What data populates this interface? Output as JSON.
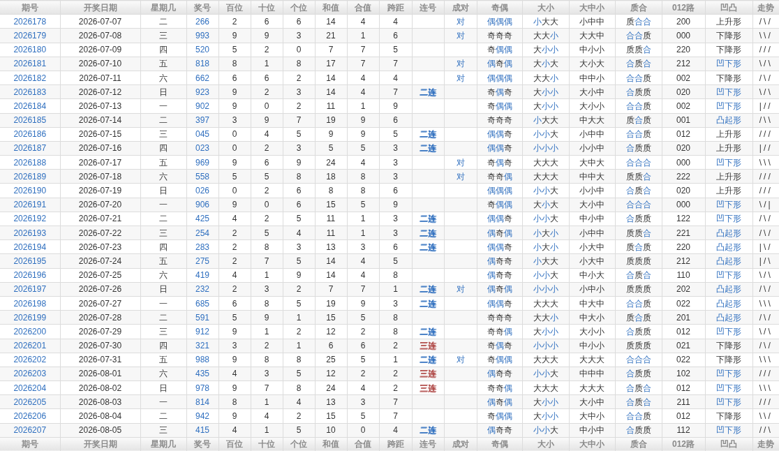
{
  "columns": [
    "期号",
    "开奖日期",
    "星期几",
    "奖号",
    "百位",
    "十位",
    "个位",
    "和值",
    "合值",
    "跨距",
    "连号",
    "成对",
    "奇偶",
    "大小",
    "大中小",
    "质合",
    "012路",
    "凹凸",
    "走势"
  ],
  "rows": [
    {
      "issue": "2026178",
      "date": "2026-07-07",
      "weekday": "二",
      "number": "266",
      "hundreds": "2",
      "tens": "6",
      "units": "6",
      "sum": "14",
      "sum_tail": "4",
      "span": "4",
      "pair": "对",
      "odd_even": [
        {
          "text": "偶偶偶",
          "highlight": true
        }
      ],
      "big_small": [
        {
          "text": "小",
          "highlight": true
        },
        {
          "text": "大大",
          "highlight": false
        }
      ],
      "big_mid_small": "小中中",
      "prime_composite": [
        {
          "text": "质",
          "highlight": false
        },
        {
          "text": "合合",
          "highlight": true
        }
      ],
      "route_012": "200",
      "shape": {
        "text": "上升形",
        "highlight": false
      },
      "trend": "/\\/"
    },
    {
      "issue": "2026179",
      "date": "2026-07-08",
      "weekday": "三",
      "number": "993",
      "hundreds": "9",
      "tens": "9",
      "units": "3",
      "sum": "21",
      "sum_tail": "1",
      "span": "6",
      "pair": "对",
      "odd_even": [
        {
          "text": "奇奇奇",
          "highlight": false
        }
      ],
      "big_small": [
        {
          "text": "大大",
          "highlight": false
        },
        {
          "text": "小",
          "highlight": true
        }
      ],
      "big_mid_small": "大大中",
      "prime_composite": [
        {
          "text": "合合",
          "highlight": true
        },
        {
          "text": "质",
          "highlight": false
        }
      ],
      "route_012": "000",
      "shape": {
        "text": "下降形",
        "highlight": false
      },
      "trend": "\\\\/"
    },
    {
      "issue": "2026180",
      "date": "2026-07-09",
      "weekday": "四",
      "number": "520",
      "hundreds": "5",
      "tens": "2",
      "units": "0",
      "sum": "7",
      "sum_tail": "7",
      "span": "5",
      "odd_even": [
        {
          "text": "奇",
          "highlight": false
        },
        {
          "text": "偶偶",
          "highlight": true
        }
      ],
      "big_small": [
        {
          "text": "大",
          "highlight": false
        },
        {
          "text": "小小",
          "highlight": true
        }
      ],
      "big_mid_small": "中小小",
      "prime_composite": [
        {
          "text": "质质",
          "highlight": false
        },
        {
          "text": "合",
          "highlight": true
        }
      ],
      "route_012": "220",
      "shape": {
        "text": "下降形",
        "highlight": false
      },
      "trend": "///"
    },
    {
      "issue": "2026181",
      "date": "2026-07-10",
      "weekday": "五",
      "number": "818",
      "hundreds": "8",
      "tens": "1",
      "units": "8",
      "sum": "17",
      "sum_tail": "7",
      "span": "7",
      "pair": "对",
      "odd_even": [
        {
          "text": "偶",
          "highlight": true
        },
        {
          "text": "奇",
          "highlight": false
        },
        {
          "text": "偶",
          "highlight": true
        }
      ],
      "big_small": [
        {
          "text": "大",
          "highlight": false
        },
        {
          "text": "小",
          "highlight": true
        },
        {
          "text": "大",
          "highlight": false
        }
      ],
      "big_mid_small": "大小大",
      "prime_composite": [
        {
          "text": "合",
          "highlight": true
        },
        {
          "text": "质",
          "highlight": false
        },
        {
          "text": "合",
          "highlight": true
        }
      ],
      "route_012": "212",
      "shape": {
        "text": "凹下形",
        "highlight": true
      },
      "trend": "\\/\\"
    },
    {
      "issue": "2026182",
      "date": "2026-07-11",
      "weekday": "六",
      "number": "662",
      "hundreds": "6",
      "tens": "6",
      "units": "2",
      "sum": "14",
      "sum_tail": "4",
      "span": "4",
      "pair": "对",
      "odd_even": [
        {
          "text": "偶偶偶",
          "highlight": true
        }
      ],
      "big_small": [
        {
          "text": "大大",
          "highlight": false
        },
        {
          "text": "小",
          "highlight": true
        }
      ],
      "big_mid_small": "中中小",
      "prime_composite": [
        {
          "text": "合合",
          "highlight": true
        },
        {
          "text": "质",
          "highlight": false
        }
      ],
      "route_012": "002",
      "shape": {
        "text": "下降形",
        "highlight": false
      },
      "trend": "/\\/"
    },
    {
      "issue": "2026183",
      "date": "2026-07-12",
      "weekday": "日",
      "number": "923",
      "hundreds": "9",
      "tens": "2",
      "units": "3",
      "sum": "14",
      "sum_tail": "4",
      "span": "7",
      "consecutive": {
        "text": "二连",
        "color": "#2f6fbf"
      },
      "odd_even": [
        {
          "text": "奇",
          "highlight": false
        },
        {
          "text": "偶",
          "highlight": true
        },
        {
          "text": "奇",
          "highlight": false
        }
      ],
      "big_small": [
        {
          "text": "大",
          "highlight": false
        },
        {
          "text": "小小",
          "highlight": true
        }
      ],
      "big_mid_small": "大小中",
      "prime_composite": [
        {
          "text": "合",
          "highlight": true
        },
        {
          "text": "质质",
          "highlight": false
        }
      ],
      "route_012": "020",
      "shape": {
        "text": "凹下形",
        "highlight": true
      },
      "trend": "\\/\\"
    },
    {
      "issue": "2026184",
      "date": "2026-07-13",
      "weekday": "一",
      "number": "902",
      "hundreds": "9",
      "tens": "0",
      "units": "2",
      "sum": "11",
      "sum_tail": "1",
      "span": "9",
      "odd_even": [
        {
          "text": "奇",
          "highlight": false
        },
        {
          "text": "偶偶",
          "highlight": true
        }
      ],
      "big_small": [
        {
          "text": "大",
          "highlight": false
        },
        {
          "text": "小小",
          "highlight": true
        }
      ],
      "big_mid_small": "大小小",
      "prime_composite": [
        {
          "text": "合合",
          "highlight": true
        },
        {
          "text": "质",
          "highlight": false
        }
      ],
      "route_012": "002",
      "shape": {
        "text": "凹下形",
        "highlight": true
      },
      "trend": "|//"
    },
    {
      "issue": "2026185",
      "date": "2026-07-14",
      "weekday": "二",
      "number": "397",
      "hundreds": "3",
      "tens": "9",
      "units": "7",
      "sum": "19",
      "sum_tail": "9",
      "span": "6",
      "odd_even": [
        {
          "text": "奇奇奇",
          "highlight": false
        }
      ],
      "big_small": [
        {
          "text": "小",
          "highlight": true
        },
        {
          "text": "大大",
          "highlight": false
        }
      ],
      "big_mid_small": "中大大",
      "prime_composite": [
        {
          "text": "质",
          "highlight": false
        },
        {
          "text": "合",
          "highlight": true
        },
        {
          "text": "质",
          "highlight": false
        }
      ],
      "route_012": "001",
      "shape": {
        "text": "凸起形",
        "highlight": true
      },
      "trend": "/\\\\"
    },
    {
      "issue": "2026186",
      "date": "2026-07-15",
      "weekday": "三",
      "number": "045",
      "hundreds": "0",
      "tens": "4",
      "units": "5",
      "sum": "9",
      "sum_tail": "9",
      "span": "5",
      "consecutive": {
        "text": "二连",
        "color": "#2f6fbf"
      },
      "odd_even": [
        {
          "text": "偶偶",
          "highlight": true
        },
        {
          "text": "奇",
          "highlight": false
        }
      ],
      "big_small": [
        {
          "text": "小小",
          "highlight": true
        },
        {
          "text": "大",
          "highlight": false
        }
      ],
      "big_mid_small": "小中中",
      "prime_composite": [
        {
          "text": "合合",
          "highlight": true
        },
        {
          "text": "质",
          "highlight": false
        }
      ],
      "route_012": "012",
      "shape": {
        "text": "上升形",
        "highlight": false
      },
      "trend": "///"
    },
    {
      "issue": "2026187",
      "date": "2026-07-16",
      "weekday": "四",
      "number": "023",
      "hundreds": "0",
      "tens": "2",
      "units": "3",
      "sum": "5",
      "sum_tail": "5",
      "span": "3",
      "consecutive": {
        "text": "二连",
        "color": "#2f6fbf"
      },
      "odd_even": [
        {
          "text": "偶偶",
          "highlight": true
        },
        {
          "text": "奇",
          "highlight": false
        }
      ],
      "big_small": [
        {
          "text": "小小小",
          "highlight": true
        }
      ],
      "big_mid_small": "小小中",
      "prime_composite": [
        {
          "text": "合",
          "highlight": true
        },
        {
          "text": "质质",
          "highlight": false
        }
      ],
      "route_012": "020",
      "shape": {
        "text": "上升形",
        "highlight": false
      },
      "trend": "|//"
    },
    {
      "issue": "2026188",
      "date": "2026-07-17",
      "weekday": "五",
      "number": "969",
      "hundreds": "9",
      "tens": "6",
      "units": "9",
      "sum": "24",
      "sum_tail": "4",
      "span": "3",
      "pair": "对",
      "odd_even": [
        {
          "text": "奇",
          "highlight": false
        },
        {
          "text": "偶",
          "highlight": true
        },
        {
          "text": "奇",
          "highlight": false
        }
      ],
      "big_small": [
        {
          "text": "大大大",
          "highlight": false
        }
      ],
      "big_mid_small": "大中大",
      "prime_composite": [
        {
          "text": "合合合",
          "highlight": true
        }
      ],
      "route_012": "000",
      "shape": {
        "text": "凹下形",
        "highlight": true
      },
      "trend": "\\\\\\"
    },
    {
      "issue": "2026189",
      "date": "2026-07-18",
      "weekday": "六",
      "number": "558",
      "hundreds": "5",
      "tens": "5",
      "units": "8",
      "sum": "18",
      "sum_tail": "8",
      "span": "3",
      "pair": "对",
      "odd_even": [
        {
          "text": "奇奇",
          "highlight": false
        },
        {
          "text": "偶",
          "highlight": true
        }
      ],
      "big_small": [
        {
          "text": "大大大",
          "highlight": false
        }
      ],
      "big_mid_small": "中中大",
      "prime_composite": [
        {
          "text": "质质",
          "highlight": false
        },
        {
          "text": "合",
          "highlight": true
        }
      ],
      "route_012": "222",
      "shape": {
        "text": "上升形",
        "highlight": false
      },
      "trend": "///"
    },
    {
      "issue": "2026190",
      "date": "2026-07-19",
      "weekday": "日",
      "number": "026",
      "hundreds": "0",
      "tens": "2",
      "units": "6",
      "sum": "8",
      "sum_tail": "8",
      "span": "6",
      "odd_even": [
        {
          "text": "偶偶偶",
          "highlight": true
        }
      ],
      "big_small": [
        {
          "text": "小小",
          "highlight": true
        },
        {
          "text": "大",
          "highlight": false
        }
      ],
      "big_mid_small": "小小中",
      "prime_composite": [
        {
          "text": "合",
          "highlight": true
        },
        {
          "text": "质",
          "highlight": false
        },
        {
          "text": "合",
          "highlight": true
        }
      ],
      "route_012": "020",
      "shape": {
        "text": "上升形",
        "highlight": false
      },
      "trend": "///"
    },
    {
      "issue": "2026191",
      "date": "2026-07-20",
      "weekday": "一",
      "number": "906",
      "hundreds": "9",
      "tens": "0",
      "units": "6",
      "sum": "15",
      "sum_tail": "5",
      "span": "9",
      "odd_even": [
        {
          "text": "奇",
          "highlight": false
        },
        {
          "text": "偶偶",
          "highlight": true
        }
      ],
      "big_small": [
        {
          "text": "大",
          "highlight": false
        },
        {
          "text": "小",
          "highlight": true
        },
        {
          "text": "大",
          "highlight": false
        }
      ],
      "big_mid_small": "大小中",
      "prime_composite": [
        {
          "text": "合合合",
          "highlight": true
        }
      ],
      "route_012": "000",
      "shape": {
        "text": "凹下形",
        "highlight": true
      },
      "trend": "\\/|"
    },
    {
      "issue": "2026192",
      "date": "2026-07-21",
      "weekday": "二",
      "number": "425",
      "hundreds": "4",
      "tens": "2",
      "units": "5",
      "sum": "11",
      "sum_tail": "1",
      "span": "3",
      "consecutive": {
        "text": "二连",
        "color": "#2f6fbf"
      },
      "odd_even": [
        {
          "text": "偶偶",
          "highlight": true
        },
        {
          "text": "奇",
          "highlight": false
        }
      ],
      "big_small": [
        {
          "text": "小小",
          "highlight": true
        },
        {
          "text": "大",
          "highlight": false
        }
      ],
      "big_mid_small": "中小中",
      "prime_composite": [
        {
          "text": "合",
          "highlight": true
        },
        {
          "text": "质质",
          "highlight": false
        }
      ],
      "route_012": "122",
      "shape": {
        "text": "凹下形",
        "highlight": true
      },
      "trend": "/\\/"
    },
    {
      "issue": "2026193",
      "date": "2026-07-22",
      "weekday": "三",
      "number": "254",
      "hundreds": "2",
      "tens": "5",
      "units": "4",
      "sum": "11",
      "sum_tail": "1",
      "span": "3",
      "consecutive": {
        "text": "二连",
        "color": "#2f6fbf"
      },
      "odd_even": [
        {
          "text": "偶",
          "highlight": true
        },
        {
          "text": "奇",
          "highlight": false
        },
        {
          "text": "偶",
          "highlight": true
        }
      ],
      "big_small": [
        {
          "text": "小",
          "highlight": true
        },
        {
          "text": "大",
          "highlight": false
        },
        {
          "text": "小",
          "highlight": true
        }
      ],
      "big_mid_small": "小中中",
      "prime_composite": [
        {
          "text": "质质",
          "highlight": false
        },
        {
          "text": "合",
          "highlight": true
        }
      ],
      "route_012": "221",
      "shape": {
        "text": "凸起形",
        "highlight": true
      },
      "trend": "/\\/"
    },
    {
      "issue": "2026194",
      "date": "2026-07-23",
      "weekday": "四",
      "number": "283",
      "hundreds": "2",
      "tens": "8",
      "units": "3",
      "sum": "13",
      "sum_tail": "3",
      "span": "6",
      "consecutive": {
        "text": "二连",
        "color": "#2f6fbf"
      },
      "odd_even": [
        {
          "text": "偶偶",
          "highlight": true
        },
        {
          "text": "奇",
          "highlight": false
        }
      ],
      "big_small": [
        {
          "text": "小",
          "highlight": true
        },
        {
          "text": "大",
          "highlight": false
        },
        {
          "text": "小",
          "highlight": true
        }
      ],
      "big_mid_small": "小大中",
      "prime_composite": [
        {
          "text": "质",
          "highlight": false
        },
        {
          "text": "合",
          "highlight": true
        },
        {
          "text": "质",
          "highlight": false
        }
      ],
      "route_012": "220",
      "shape": {
        "text": "凸起形",
        "highlight": true
      },
      "trend": "|\\/"
    },
    {
      "issue": "2026195",
      "date": "2026-07-24",
      "weekday": "五",
      "number": "275",
      "hundreds": "2",
      "tens": "7",
      "units": "5",
      "sum": "14",
      "sum_tail": "4",
      "span": "5",
      "odd_even": [
        {
          "text": "偶",
          "highlight": true
        },
        {
          "text": "奇奇",
          "highlight": false
        }
      ],
      "big_small": [
        {
          "text": "小",
          "highlight": true
        },
        {
          "text": "大大",
          "highlight": false
        }
      ],
      "big_mid_small": "小大中",
      "prime_composite": [
        {
          "text": "质质质",
          "highlight": false
        }
      ],
      "route_012": "212",
      "shape": {
        "text": "凸起形",
        "highlight": true
      },
      "trend": "|/\\"
    },
    {
      "issue": "2026196",
      "date": "2026-07-25",
      "weekday": "六",
      "number": "419",
      "hundreds": "4",
      "tens": "1",
      "units": "9",
      "sum": "14",
      "sum_tail": "4",
      "span": "8",
      "odd_even": [
        {
          "text": "偶",
          "highlight": true
        },
        {
          "text": "奇奇",
          "highlight": false
        }
      ],
      "big_small": [
        {
          "text": "小小",
          "highlight": true
        },
        {
          "text": "大",
          "highlight": false
        }
      ],
      "big_mid_small": "中小大",
      "prime_composite": [
        {
          "text": "合",
          "highlight": true
        },
        {
          "text": "质",
          "highlight": false
        },
        {
          "text": "合",
          "highlight": true
        }
      ],
      "route_012": "110",
      "shape": {
        "text": "凹下形",
        "highlight": true
      },
      "trend": "\\/\\"
    },
    {
      "issue": "2026197",
      "date": "2026-07-26",
      "weekday": "日",
      "number": "232",
      "hundreds": "2",
      "tens": "3",
      "units": "2",
      "sum": "7",
      "sum_tail": "7",
      "span": "1",
      "consecutive": {
        "text": "二连",
        "color": "#2f6fbf"
      },
      "pair": "对",
      "odd_even": [
        {
          "text": "偶",
          "highlight": true
        },
        {
          "text": "奇",
          "highlight": false
        },
        {
          "text": "偶",
          "highlight": true
        }
      ],
      "big_small": [
        {
          "text": "小小小",
          "highlight": true
        }
      ],
      "big_mid_small": "小中小",
      "prime_composite": [
        {
          "text": "质质质",
          "highlight": false
        }
      ],
      "route_012": "202",
      "shape": {
        "text": "凸起形",
        "highlight": true
      },
      "trend": "/\\/"
    },
    {
      "issue": "2026198",
      "date": "2026-07-27",
      "weekday": "一",
      "number": "685",
      "hundreds": "6",
      "tens": "8",
      "units": "5",
      "sum": "19",
      "sum_tail": "9",
      "span": "3",
      "consecutive": {
        "text": "二连",
        "color": "#2f6fbf"
      },
      "odd_even": [
        {
          "text": "偶偶",
          "highlight": true
        },
        {
          "text": "奇",
          "highlight": false
        }
      ],
      "big_small": [
        {
          "text": "大大大",
          "highlight": false
        }
      ],
      "big_mid_small": "中大中",
      "prime_composite": [
        {
          "text": "合合",
          "highlight": true
        },
        {
          "text": "质",
          "highlight": false
        }
      ],
      "route_012": "022",
      "shape": {
        "text": "凸起形",
        "highlight": true
      },
      "trend": "\\\\\\"
    },
    {
      "issue": "2026199",
      "date": "2026-07-28",
      "weekday": "二",
      "number": "591",
      "hundreds": "5",
      "tens": "9",
      "units": "1",
      "sum": "15",
      "sum_tail": "5",
      "span": "8",
      "odd_even": [
        {
          "text": "奇奇奇",
          "highlight": false
        }
      ],
      "big_small": [
        {
          "text": "大大",
          "highlight": false
        },
        {
          "text": "小",
          "highlight": true
        }
      ],
      "big_mid_small": "中大小",
      "prime_composite": [
        {
          "text": "质",
          "highlight": false
        },
        {
          "text": "合",
          "highlight": true
        },
        {
          "text": "质",
          "highlight": false
        }
      ],
      "route_012": "201",
      "shape": {
        "text": "凸起形",
        "highlight": true
      },
      "trend": "/\\/"
    },
    {
      "issue": "2026200",
      "date": "2026-07-29",
      "weekday": "三",
      "number": "912",
      "hundreds": "9",
      "tens": "1",
      "units": "2",
      "sum": "12",
      "sum_tail": "2",
      "span": "8",
      "consecutive": {
        "text": "二连",
        "color": "#2f6fbf"
      },
      "odd_even": [
        {
          "text": "奇奇",
          "highlight": false
        },
        {
          "text": "偶",
          "highlight": true
        }
      ],
      "big_small": [
        {
          "text": "大",
          "highlight": false
        },
        {
          "text": "小小",
          "highlight": true
        }
      ],
      "big_mid_small": "大小小",
      "prime_composite": [
        {
          "text": "合",
          "highlight": true
        },
        {
          "text": "质质",
          "highlight": false
        }
      ],
      "route_012": "012",
      "shape": {
        "text": "凹下形",
        "highlight": true
      },
      "trend": "\\/\\"
    },
    {
      "issue": "2026201",
      "date": "2026-07-30",
      "weekday": "四",
      "number": "321",
      "hundreds": "3",
      "tens": "2",
      "units": "1",
      "sum": "6",
      "sum_tail": "6",
      "span": "2",
      "consecutive": {
        "text": "三连",
        "color": "#b04a48"
      },
      "odd_even": [
        {
          "text": "奇",
          "highlight": false
        },
        {
          "text": "偶",
          "highlight": true
        },
        {
          "text": "奇",
          "highlight": false
        }
      ],
      "big_small": [
        {
          "text": "小小小",
          "highlight": true
        }
      ],
      "big_mid_small": "中小小",
      "prime_composite": [
        {
          "text": "质质质",
          "highlight": false
        }
      ],
      "route_012": "021",
      "shape": {
        "text": "下降形",
        "highlight": false
      },
      "trend": "/\\/"
    },
    {
      "issue": "2026202",
      "date": "2026-07-31",
      "weekday": "五",
      "number": "988",
      "hundreds": "9",
      "tens": "8",
      "units": "8",
      "sum": "25",
      "sum_tail": "5",
      "span": "1",
      "consecutive": {
        "text": "二连",
        "color": "#2f6fbf"
      },
      "pair": "对",
      "odd_even": [
        {
          "text": "奇",
          "highlight": false
        },
        {
          "text": "偶偶",
          "highlight": true
        }
      ],
      "big_small": [
        {
          "text": "大大大",
          "highlight": false
        }
      ],
      "big_mid_small": "大大大",
      "prime_composite": [
        {
          "text": "合合合",
          "highlight": true
        }
      ],
      "route_012": "022",
      "shape": {
        "text": "下降形",
        "highlight": false
      },
      "trend": "\\\\\\"
    },
    {
      "issue": "2026203",
      "date": "2026-08-01",
      "weekday": "六",
      "number": "435",
      "hundreds": "4",
      "tens": "3",
      "units": "5",
      "sum": "12",
      "sum_tail": "2",
      "span": "2",
      "consecutive": {
        "text": "三连",
        "color": "#b04a48"
      },
      "odd_even": [
        {
          "text": "偶",
          "highlight": true
        },
        {
          "text": "奇奇",
          "highlight": false
        }
      ],
      "big_small": [
        {
          "text": "小小",
          "highlight": true
        },
        {
          "text": "大",
          "highlight": false
        }
      ],
      "big_mid_small": "中中中",
      "prime_composite": [
        {
          "text": "合",
          "highlight": true
        },
        {
          "text": "质质",
          "highlight": false
        }
      ],
      "route_012": "102",
      "shape": {
        "text": "凹下形",
        "highlight": true
      },
      "trend": "///"
    },
    {
      "issue": "2026204",
      "date": "2026-08-02",
      "weekday": "日",
      "number": "978",
      "hundreds": "9",
      "tens": "7",
      "units": "8",
      "sum": "24",
      "sum_tail": "4",
      "span": "2",
      "consecutive": {
        "text": "三连",
        "color": "#b04a48"
      },
      "odd_even": [
        {
          "text": "奇奇",
          "highlight": false
        },
        {
          "text": "偶",
          "highlight": true
        }
      ],
      "big_small": [
        {
          "text": "大大大",
          "highlight": false
        }
      ],
      "big_mid_small": "大大大",
      "prime_composite": [
        {
          "text": "合",
          "highlight": true
        },
        {
          "text": "质",
          "highlight": false
        },
        {
          "text": "合",
          "highlight": true
        }
      ],
      "route_012": "012",
      "shape": {
        "text": "凹下形",
        "highlight": true
      },
      "trend": "\\\\\\"
    },
    {
      "issue": "2026205",
      "date": "2026-08-03",
      "weekday": "一",
      "number": "814",
      "hundreds": "8",
      "tens": "1",
      "units": "4",
      "sum": "13",
      "sum_tail": "3",
      "span": "7",
      "odd_even": [
        {
          "text": "偶",
          "highlight": true
        },
        {
          "text": "奇",
          "highlight": false
        },
        {
          "text": "偶",
          "highlight": true
        }
      ],
      "big_small": [
        {
          "text": "大",
          "highlight": false
        },
        {
          "text": "小小",
          "highlight": true
        }
      ],
      "big_mid_small": "大小中",
      "prime_composite": [
        {
          "text": "合",
          "highlight": true
        },
        {
          "text": "质",
          "highlight": false
        },
        {
          "text": "合",
          "highlight": true
        }
      ],
      "route_012": "211",
      "shape": {
        "text": "凹下形",
        "highlight": true
      },
      "trend": "///"
    },
    {
      "issue": "2026206",
      "date": "2026-08-04",
      "weekday": "二",
      "number": "942",
      "hundreds": "9",
      "tens": "4",
      "units": "2",
      "sum": "15",
      "sum_tail": "5",
      "span": "7",
      "odd_even": [
        {
          "text": "奇",
          "highlight": false
        },
        {
          "text": "偶偶",
          "highlight": true
        }
      ],
      "big_small": [
        {
          "text": "大",
          "highlight": false
        },
        {
          "text": "小小",
          "highlight": true
        }
      ],
      "big_mid_small": "大中小",
      "prime_composite": [
        {
          "text": "合合",
          "highlight": true
        },
        {
          "text": "质",
          "highlight": false
        }
      ],
      "route_012": "012",
      "shape": {
        "text": "下降形",
        "highlight": false
      },
      "trend": "\\\\/"
    },
    {
      "issue": "2026207",
      "date": "2026-08-05",
      "weekday": "三",
      "number": "415",
      "hundreds": "4",
      "tens": "1",
      "units": "5",
      "sum": "10",
      "sum_tail": "0",
      "span": "4",
      "consecutive": {
        "text": "二连",
        "color": "#2f6fbf"
      },
      "odd_even": [
        {
          "text": "偶",
          "highlight": true
        },
        {
          "text": "奇奇",
          "highlight": false
        }
      ],
      "big_small": [
        {
          "text": "小小",
          "highlight": true
        },
        {
          "text": "大",
          "highlight": false
        }
      ],
      "big_mid_small": "中小中",
      "prime_composite": [
        {
          "text": "合",
          "highlight": true
        },
        {
          "text": "质质",
          "highlight": false
        }
      ],
      "route_012": "112",
      "shape": {
        "text": "凹下形",
        "highlight": true
      },
      "trend": "//\\"
    }
  ],
  "footer_columns": [
    "期号",
    "开奖日期",
    "星期几",
    "奖号",
    "百位",
    "十位",
    "个位",
    "和值",
    "合值",
    "跨距",
    "连号",
    "成对",
    "奇偶",
    "大小",
    "大中小",
    "质合",
    "012路",
    "凹凸",
    "走势"
  ]
}
